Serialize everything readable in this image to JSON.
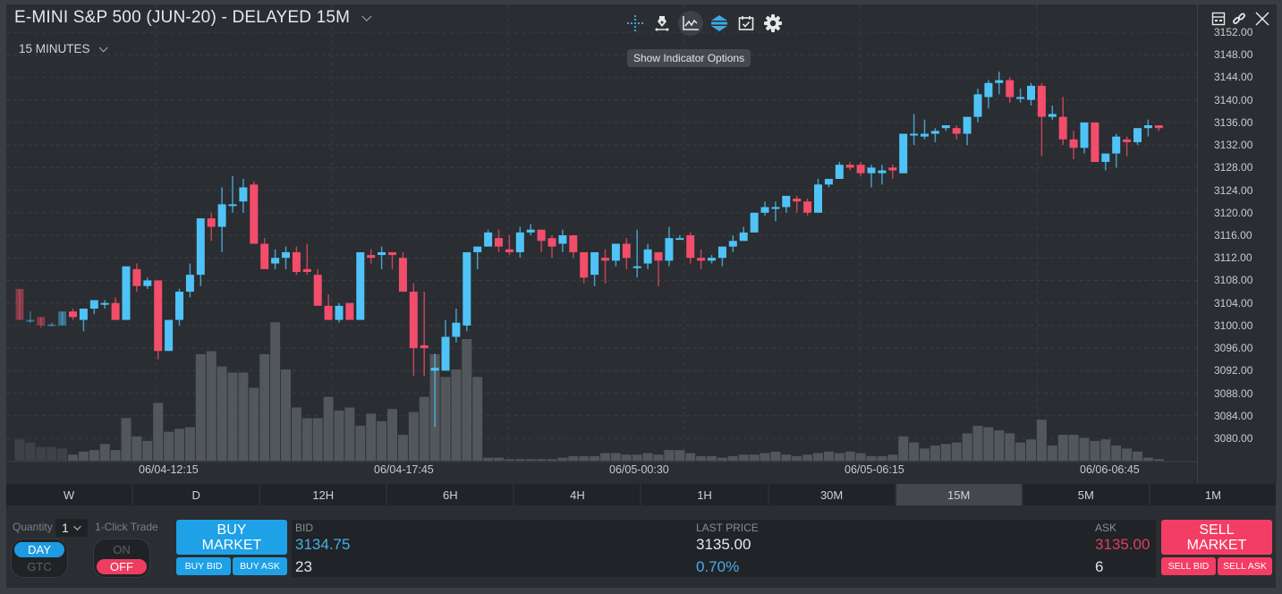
{
  "header": {
    "title": "E-MINI S&P 500 (JUN-20) - DELAYED 15M",
    "interval": "15 MINUTES"
  },
  "toolbar": {
    "tools": [
      {
        "name": "crosshair-icon"
      },
      {
        "name": "drawing-pen-icon"
      },
      {
        "name": "indicator-chart-icon",
        "active": true
      },
      {
        "name": "layers-icon"
      },
      {
        "name": "calendar-events-icon"
      },
      {
        "name": "settings-gear-icon"
      }
    ],
    "tooltip": "Show Indicator Options"
  },
  "window_controls": [
    "layout-icon",
    "link-icon",
    "close-icon"
  ],
  "colors": {
    "up": "#4fc3f7",
    "down": "#f24d6b",
    "volume": "#51575b",
    "buy": "#1ea1e6",
    "sell": "#f43d64",
    "bid_text": "#4aaee6",
    "ask_text": "#d9435e"
  },
  "chart_data": {
    "type": "candlestick",
    "title": "E-MINI S&P 500 (JUN-20) - DELAYED 15M",
    "interval": "15 MINUTES",
    "ylim": [
      3076,
      3152
    ],
    "y_ticks": [
      "3152.00",
      "3148.00",
      "3144.00",
      "3140.00",
      "3136.00",
      "3132.00",
      "3128.00",
      "3124.00",
      "3120.00",
      "3116.00",
      "3112.00",
      "3108.00",
      "3104.00",
      "3100.00",
      "3096.00",
      "3092.00",
      "3088.00",
      "3084.00",
      "3080.00"
    ],
    "x_tick_labels": [
      "06/04-12:15",
      "06/04-17:45",
      "06/05-00:30",
      "06/05-06:15",
      "06/06-06:45"
    ],
    "grid": true,
    "series_fields": [
      "open",
      "high",
      "low",
      "close",
      "volume"
    ],
    "candles": [
      [
        3106.5,
        3106.5,
        3101.0,
        3101.0,
        14
      ],
      [
        3101.0,
        3102.5,
        3100.5,
        3101.0,
        12
      ],
      [
        3101.5,
        3101.5,
        3099.5,
        3100.0,
        9
      ],
      [
        3100.0,
        3100.5,
        3100.0,
        3100.2,
        9
      ],
      [
        3100.0,
        3102.5,
        3100.0,
        3102.5,
        8
      ],
      [
        3102.5,
        3103.0,
        3101.0,
        3101.5,
        4
      ],
      [
        3101.0,
        3103.0,
        3099.0,
        3103.0,
        6
      ],
      [
        3103.0,
        3104.5,
        3102.0,
        3104.5,
        7
      ],
      [
        3104.0,
        3104.5,
        3103.0,
        3104.0,
        11
      ],
      [
        3104.0,
        3105.0,
        3101.5,
        3101.0,
        7
      ],
      [
        3101.0,
        3110.0,
        3101.0,
        3110.5,
        28
      ],
      [
        3110.0,
        3111.0,
        3106.0,
        3107.0,
        16
      ],
      [
        3107.0,
        3108.5,
        3106.5,
        3108.0,
        13
      ],
      [
        3108.0,
        3108.0,
        3094.0,
        3095.5,
        38
      ],
      [
        3095.5,
        3101.0,
        3095.5,
        3101.0,
        19
      ],
      [
        3101.0,
        3106.5,
        3100.0,
        3106.0,
        21
      ],
      [
        3106.0,
        3111.0,
        3105.0,
        3109.0,
        22
      ],
      [
        3109.0,
        3119.0,
        3107.0,
        3119.0,
        70
      ],
      [
        3119.0,
        3120.0,
        3115.0,
        3117.5,
        72
      ],
      [
        3117.5,
        3124.5,
        3113.0,
        3121.5,
        62
      ],
      [
        3121.5,
        3126.5,
        3120.0,
        3121.5,
        58
      ],
      [
        3122.0,
        3126.0,
        3120.0,
        3124.5,
        58
      ],
      [
        3125.0,
        3125.5,
        3114.5,
        3114.5,
        48
      ],
      [
        3114.5,
        3115.5,
        3111.5,
        3110.0,
        70
      ],
      [
        3111.0,
        3113.5,
        3110.0,
        3112.0,
        91
      ],
      [
        3112.0,
        3114.0,
        3110.0,
        3113.0,
        60
      ],
      [
        3113.0,
        3114.0,
        3109.0,
        3109.5,
        35
      ],
      [
        3110.0,
        3114.5,
        3109.0,
        3109.5,
        28
      ],
      [
        3109.0,
        3110.0,
        3104.5,
        3103.5,
        28
      ],
      [
        3103.5,
        3105.5,
        3101.5,
        3101.0,
        42
      ],
      [
        3101.0,
        3104.0,
        3100.5,
        3103.5,
        33
      ],
      [
        3104.0,
        3104.0,
        3101.0,
        3101.0,
        35
      ],
      [
        3101.0,
        3113.0,
        3101.0,
        3113.0,
        23
      ],
      [
        3112.5,
        3113.5,
        3111.0,
        3112.0,
        31
      ],
      [
        3112.5,
        3114.0,
        3110.0,
        3113.0,
        26
      ],
      [
        3113.0,
        3113.0,
        3110.0,
        3112.5,
        34
      ],
      [
        3112.0,
        3113.0,
        3106.0,
        3106.0,
        17
      ],
      [
        3106.0,
        3107.5,
        3091.0,
        3096.0,
        32
      ],
      [
        3096.5,
        3106.0,
        3091.0,
        3096.0,
        42
      ],
      [
        3092.0,
        3095.0,
        3082.0,
        3092.5,
        70
      ],
      [
        3092.0,
        3101.0,
        3094.0,
        3098.0,
        55
      ],
      [
        3098.0,
        3103.0,
        3097.0,
        3100.5,
        60
      ],
      [
        3100.0,
        3113.0,
        3099.0,
        3113.0,
        80
      ],
      [
        3113.0,
        3113.0,
        3110.0,
        3114.0,
        55
      ],
      [
        3114.0,
        3117.0,
        3114.0,
        3116.5,
        2
      ],
      [
        3115.5,
        3117.0,
        3113.0,
        3114.0,
        2
      ],
      [
        3113.5,
        3116.0,
        3112.5,
        3113.0,
        1
      ],
      [
        3113.0,
        3117.5,
        3112.0,
        3116.5,
        1
      ],
      [
        3116.5,
        3118.0,
        3116.0,
        3117.0,
        1
      ],
      [
        3117.0,
        3117.0,
        3113.0,
        3115.0,
        1
      ],
      [
        3115.5,
        3116.0,
        3112.0,
        3114.0,
        1
      ],
      [
        3114.5,
        3117.0,
        3113.0,
        3116.0,
        2
      ],
      [
        3116.0,
        3116.0,
        3112.0,
        3113.0,
        3
      ],
      [
        3113.0,
        3113.0,
        3107.5,
        3108.5,
        3
      ],
      [
        3109.0,
        3113.0,
        3107.0,
        3113.0,
        3
      ],
      [
        3112.0,
        3113.5,
        3107.5,
        3111.5,
        5
      ],
      [
        3111.5,
        3114.5,
        3110.5,
        3114.5,
        5
      ],
      [
        3114.5,
        3115.5,
        3110.0,
        3112.0,
        4
      ],
      [
        3110.5,
        3117.0,
        3108.5,
        3110.5,
        4
      ],
      [
        3111.0,
        3114.5,
        3110.0,
        3113.5,
        5
      ],
      [
        3113.0,
        3112.0,
        3107.0,
        3111.5,
        4
      ],
      [
        3111.5,
        3117.5,
        3110.5,
        3115.5,
        7
      ],
      [
        3115.5,
        3116.0,
        3115.5,
        3115.5,
        7
      ],
      [
        3116.0,
        3116.5,
        3111.0,
        3112.0,
        5
      ],
      [
        3112.0,
        3113.5,
        3110.0,
        3111.5,
        3
      ],
      [
        3111.5,
        3112.5,
        3111.0,
        3112.0,
        3
      ],
      [
        3112.0,
        3114.0,
        3110.5,
        3114.0,
        2
      ],
      [
        3114.0,
        3116.0,
        3113.0,
        3115.0,
        3
      ],
      [
        3115.0,
        3117.5,
        3115.0,
        3116.5,
        4
      ],
      [
        3116.5,
        3119.5,
        3116.5,
        3120.0,
        4
      ],
      [
        3120.0,
        3122.0,
        3119.5,
        3121.0,
        5
      ],
      [
        3121.0,
        3122.0,
        3118.5,
        3121.0,
        6
      ],
      [
        3121.0,
        3123.0,
        3120.0,
        3123.0,
        4
      ],
      [
        3122.5,
        3123.0,
        3120.0,
        3122.0,
        3
      ],
      [
        3122.0,
        3122.5,
        3119.5,
        3120.0,
        4
      ],
      [
        3120.0,
        3126.0,
        3120.0,
        3125.0,
        5
      ],
      [
        3125.0,
        3125.5,
        3124.5,
        3126.0,
        6
      ],
      [
        3126.0,
        3129.0,
        3126.0,
        3128.5,
        5
      ],
      [
        3128.5,
        3129.0,
        3127.5,
        3128.0,
        6
      ],
      [
        3128.5,
        3129.0,
        3126.5,
        3127.0,
        5
      ],
      [
        3127.0,
        3128.5,
        3124.5,
        3128.0,
        3
      ],
      [
        3127.0,
        3128.5,
        3125.0,
        3127.5,
        3
      ],
      [
        3128.0,
        3128.5,
        3126.0,
        3127.5,
        4
      ],
      [
        3127.0,
        3134.0,
        3127.0,
        3134.0,
        16
      ],
      [
        3134.0,
        3137.5,
        3132.0,
        3134.0,
        12
      ],
      [
        3133.5,
        3136.5,
        3133.0,
        3134.0,
        8
      ],
      [
        3134.0,
        3135.0,
        3132.5,
        3134.5,
        10
      ],
      [
        3135.0,
        3135.5,
        3134.5,
        3135.5,
        11
      ],
      [
        3135.0,
        3135.5,
        3133.0,
        3134.0,
        12
      ],
      [
        3134.0,
        3137.0,
        3132.0,
        3137.0,
        18
      ],
      [
        3137.0,
        3142.0,
        3136.0,
        3141.0,
        23
      ],
      [
        3140.5,
        3143.5,
        3138.5,
        3143.0,
        22
      ],
      [
        3143.0,
        3145.0,
        3141.0,
        3143.5,
        20
      ],
      [
        3143.5,
        3144.0,
        3139.5,
        3140.5,
        18
      ],
      [
        3140.5,
        3142.0,
        3139.5,
        3140.5,
        12
      ],
      [
        3140.0,
        3143.0,
        3139.0,
        3142.5,
        14
      ],
      [
        3142.5,
        3143.0,
        3130.0,
        3137.0,
        27
      ],
      [
        3137.0,
        3139.0,
        3136.5,
        3137.5,
        10
      ],
      [
        3137.0,
        3140.5,
        3132.0,
        3133.0,
        17
      ],
      [
        3133.0,
        3134.5,
        3129.5,
        3131.5,
        17
      ],
      [
        3131.5,
        3136.0,
        3130.5,
        3136.0,
        15
      ],
      [
        3136.0,
        3136.0,
        3129.0,
        3129.0,
        13
      ],
      [
        3129.0,
        3130.0,
        3127.5,
        3130.5,
        14
      ],
      [
        3130.5,
        3134.0,
        3128.0,
        3133.5,
        10
      ],
      [
        3133.0,
        3133.5,
        3130.0,
        3132.5,
        8
      ],
      [
        3132.5,
        3135.0,
        3132.0,
        3135.0,
        6
      ],
      [
        3135.0,
        3136.5,
        3133.5,
        3135.5,
        2
      ],
      [
        3135.5,
        3135.5,
        3134.5,
        3135.0,
        1
      ]
    ]
  },
  "timeframes": [
    {
      "label": "W"
    },
    {
      "label": "D"
    },
    {
      "label": "12H"
    },
    {
      "label": "6H"
    },
    {
      "label": "4H"
    },
    {
      "label": "1H"
    },
    {
      "label": "30M"
    },
    {
      "label": "15M",
      "active": true
    },
    {
      "label": "5M"
    },
    {
      "label": "1M"
    }
  ],
  "trade": {
    "quantity_label": "Quantity",
    "quantity_value": "1",
    "one_click_label": "1-Click Trade",
    "tif": {
      "day": "DAY",
      "gtc": "GTC",
      "selected": "DAY"
    },
    "one_click": {
      "on": "ON",
      "off": "OFF",
      "selected": "OFF"
    },
    "buy_market": [
      "BUY",
      "MARKET"
    ],
    "buy_bid": "BUY BID",
    "buy_ask": "BUY ASK",
    "sell_market": [
      "SELL",
      "MARKET"
    ],
    "sell_bid": "SELL BID",
    "sell_ask": "SELL ASK",
    "bid_label": "BID",
    "bid_price": "3134.75",
    "bid_size": "23",
    "last_label": "LAST PRICE",
    "last_price": "3135.00",
    "change_pct": "0.70%",
    "ask_label": "ASK",
    "ask_price": "3135.00",
    "ask_size": "6"
  }
}
